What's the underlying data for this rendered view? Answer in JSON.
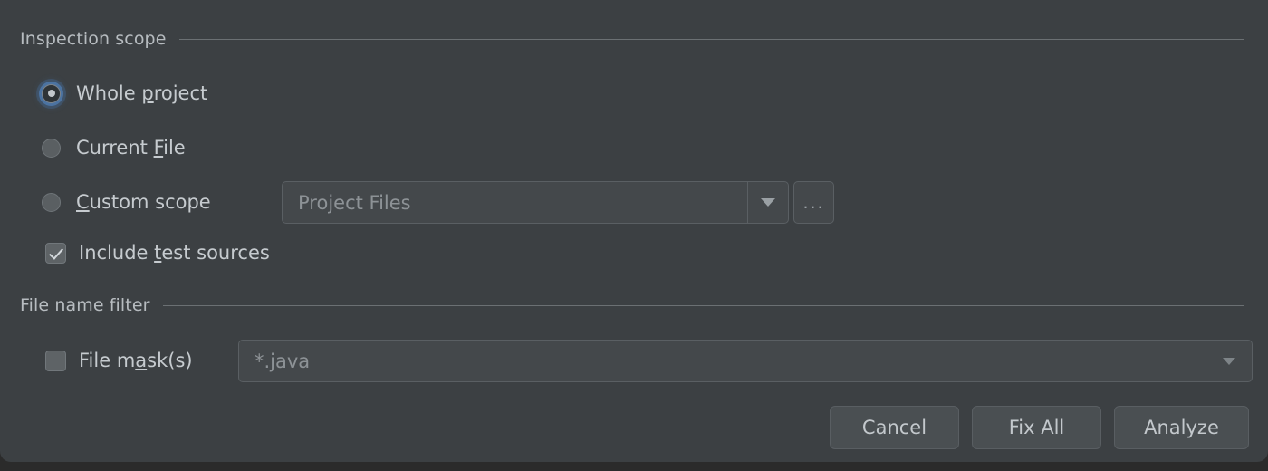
{
  "dialog": {
    "background_color": "#3c4043",
    "sections": {
      "scope": {
        "title": "Inspection scope"
      },
      "filter": {
        "title": "File name filter"
      }
    },
    "scope_options": [
      {
        "id": "whole-project",
        "label_pre": "Whole ",
        "mnemonic": "p",
        "label_post": "roject",
        "selected": true
      },
      {
        "id": "current-file",
        "label_pre": "Current ",
        "mnemonic": "F",
        "label_post": "ile",
        "selected": false
      },
      {
        "id": "custom-scope",
        "label_pre": "",
        "mnemonic": "C",
        "label_post": "ustom scope",
        "selected": false
      }
    ],
    "include_test_sources": {
      "label_pre": "Include ",
      "mnemonic": "t",
      "label_post": "est sources",
      "checked": true
    },
    "custom_scope_combo": {
      "value": "Project Files",
      "arrow_icon": "chevron-down-icon",
      "enabled": false
    },
    "browse_button": {
      "label": "...",
      "icon": "ellipsis-icon"
    },
    "file_mask": {
      "label_pre": "File m",
      "mnemonic": "a",
      "label_post": "sk(s)",
      "checked": false,
      "value": "*.java",
      "arrow_icon": "chevron-down-icon",
      "enabled": false
    },
    "buttons": {
      "cancel": "Cancel",
      "fix_all": "Fix All",
      "analyze": "Analyze"
    },
    "colors": {
      "surface": "#3c4043",
      "control_face": "#44484b",
      "button_face": "#4a4f52",
      "text": "#c6cbcf",
      "muted_text": "#8d9296",
      "separator": "#6b7073",
      "focus_ring": "#558ccd"
    }
  }
}
